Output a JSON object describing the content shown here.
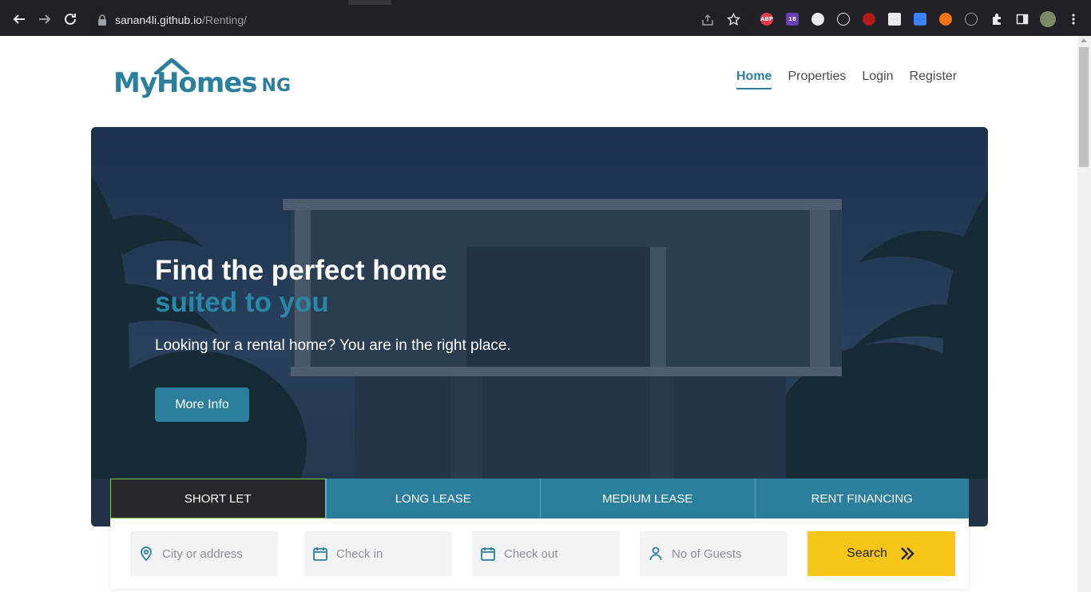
{
  "browser": {
    "url_host": "sanan4li.github.io",
    "url_path": "/Renting/",
    "extensions": [
      {
        "name": "adblock-plus-icon",
        "label": "ABP",
        "color": "#e8384f"
      },
      {
        "name": "purple-ext-icon",
        "label": "18",
        "color": "#6a3fb5"
      },
      {
        "name": "face-ext-icon",
        "label": "",
        "color": "#e8eaed"
      },
      {
        "name": "react-devtools-icon",
        "label": "",
        "color": "#202124"
      },
      {
        "name": "red-ext-icon",
        "label": "",
        "color": "#b31b1b"
      },
      {
        "name": "doc-ext-icon",
        "label": "",
        "color": "#e8eaed"
      },
      {
        "name": "blue-ext-icon",
        "label": "",
        "color": "#3b82f6"
      },
      {
        "name": "orange-ext-icon",
        "label": "",
        "color": "#f97316"
      },
      {
        "name": "globe-ext-icon",
        "label": "",
        "color": "#9aa0a6"
      }
    ]
  },
  "logo": {
    "my": "My",
    "homes": "Homes",
    "ng": "NG"
  },
  "nav": {
    "items": [
      "Home",
      "Properties",
      "Login",
      "Register"
    ],
    "active": "Home"
  },
  "hero": {
    "title_line1": "Find the perfect home",
    "title_line2": "suited to you",
    "subtitle": "Looking for a rental home? You are in the right place.",
    "button": "More Info"
  },
  "tabs": [
    "SHORT LET",
    "LONG LEASE",
    "MEDIUM LEASE",
    "RENT FINANCING"
  ],
  "search": {
    "location_placeholder": "City or address",
    "checkin_placeholder": "Check in",
    "checkout_placeholder": "Check out",
    "guests_placeholder": "No of Guests",
    "button": "Search"
  },
  "colors": {
    "brand": "#2b7f9c",
    "search_button": "#f5c518",
    "active_tab": "#26282b"
  }
}
